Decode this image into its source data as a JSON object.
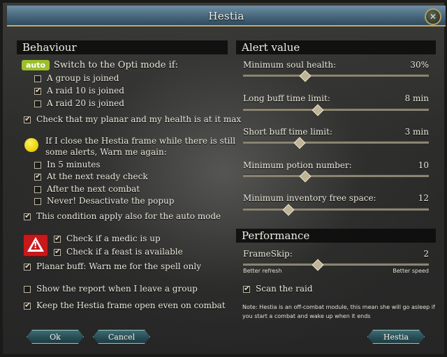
{
  "window": {
    "title": "Hestia",
    "close_glyph": "✕"
  },
  "behaviour": {
    "header": "Behaviour",
    "auto_label": "auto",
    "opti_text": "Switch to the Opti mode if:",
    "opti_options": [
      {
        "label": "A group is joined",
        "checked": false
      },
      {
        "label": "A raid 10 is joined",
        "checked": true
      },
      {
        "label": "A raid 20 is joined",
        "checked": false
      }
    ],
    "planar_health": {
      "label": "Check that my planar and my health is at it max",
      "checked": true
    },
    "warn_text_1": "If I close the Hestia frame while there is still",
    "warn_text_2": "some alerts, Warn me again:",
    "warn_options": [
      {
        "label": "In 5 minutes",
        "checked": false
      },
      {
        "label": "At the next ready check",
        "checked": true
      },
      {
        "label": "After the next combat",
        "checked": false
      },
      {
        "label": "Never! Desactivate the popup",
        "checked": false
      }
    ],
    "auto_mode": {
      "label": "This condition apply also for the auto mode",
      "checked": true
    },
    "medic": {
      "label": "Check if a medic is up",
      "checked": true
    },
    "feast": {
      "label": "Check if a feast is available",
      "checked": true
    },
    "planar_buff": {
      "label": "Planar buff: Warn me for the spell only",
      "checked": true
    },
    "show_report": {
      "label": "Show the report when I leave a group",
      "checked": false
    },
    "keep_open": {
      "label": "Keep the Hestia frame open even on combat",
      "checked": true
    }
  },
  "alert": {
    "header": "Alert value",
    "sliders": [
      {
        "label": "Minimum soul health:",
        "value": "30%",
        "fraction": 0.33
      },
      {
        "label": "Long buff time limit:",
        "value": "8 min",
        "fraction": 0.4
      },
      {
        "label": "Short buff time limit:",
        "value": "3 min",
        "fraction": 0.3
      },
      {
        "label": "Minimum potion number:",
        "value": "10",
        "fraction": 0.33
      },
      {
        "label": "Minimum inventory free space:",
        "value": "12",
        "fraction": 0.24
      }
    ]
  },
  "performance": {
    "header": "Performance",
    "frameskip_label": "FrameSkip:",
    "frameskip_value": "2",
    "frameskip_fraction": 0.4,
    "better_refresh": "Better refresh",
    "better_speed": "Better speed",
    "scan_raid": {
      "label": "Scan the raid",
      "checked": true
    },
    "note": "Note: Hestia is an off-combat module, this mean she will go asleep if you start a combat and wake up when it ends"
  },
  "buttons": {
    "ok": "Ok",
    "cancel": "Cancel",
    "hestia": "Hestia"
  },
  "colors": {
    "auto_badge": "#9bbf2a",
    "warning": "#c8181b",
    "yellow_dot": "#e8d000"
  }
}
